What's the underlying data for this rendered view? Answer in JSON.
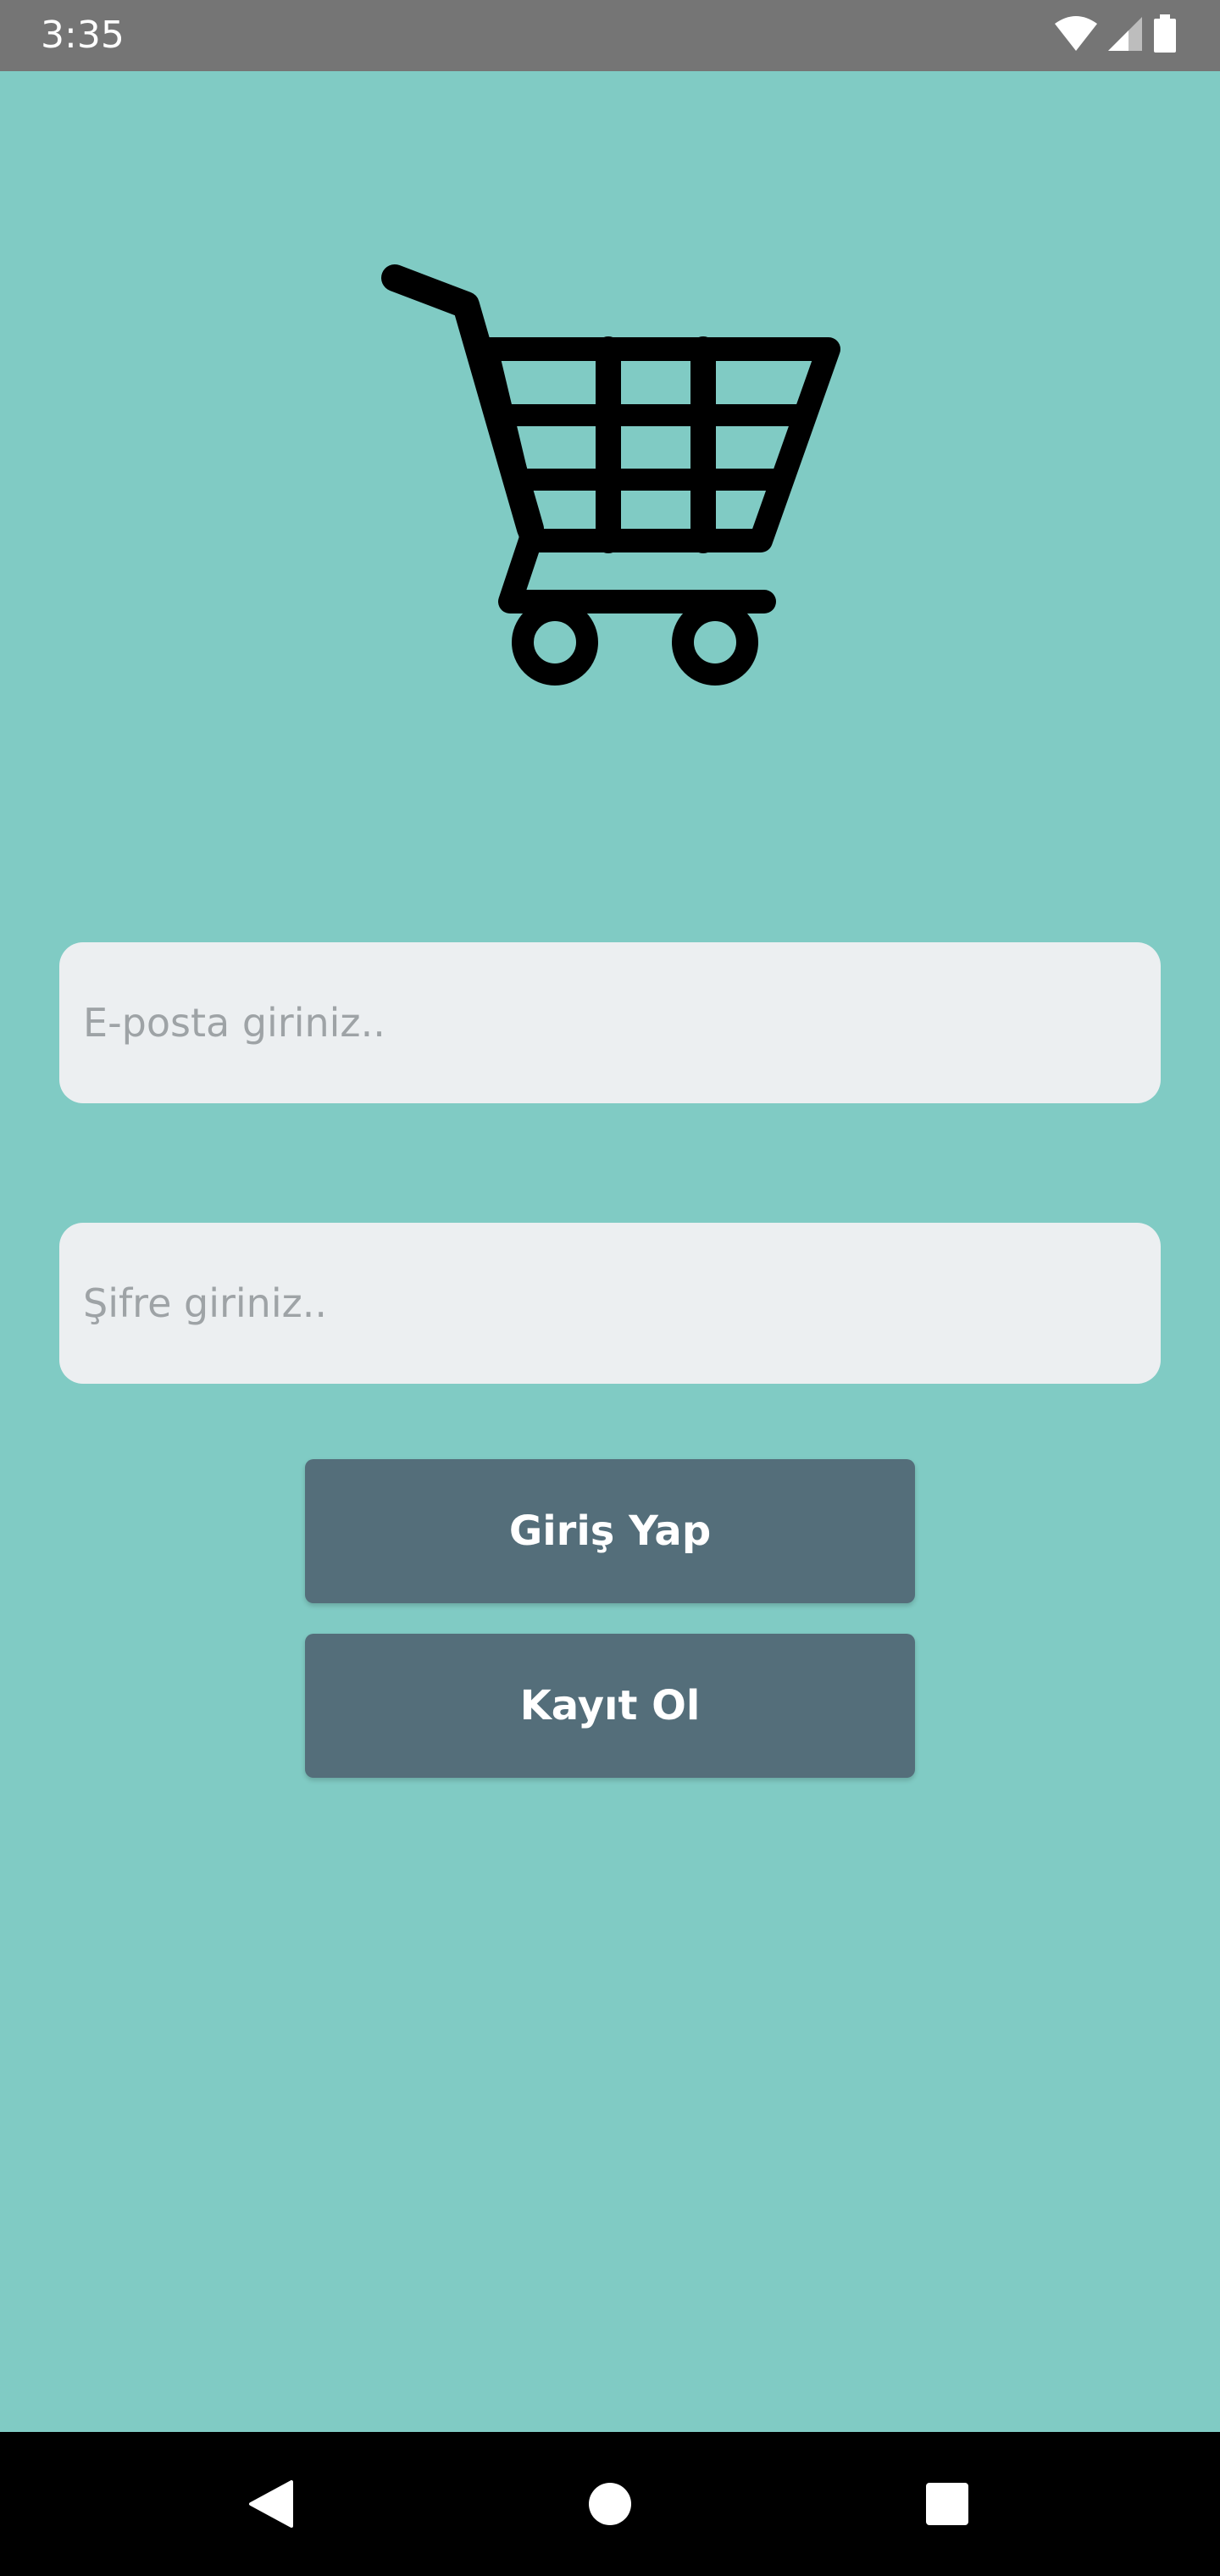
{
  "status_bar": {
    "time": "3:35",
    "icons": [
      "wifi-icon",
      "cellular-signal-icon",
      "battery-icon"
    ]
  },
  "logo": {
    "icon": "shopping-cart-icon"
  },
  "form": {
    "email": {
      "placeholder": "E-posta giriniz..",
      "value": ""
    },
    "password": {
      "placeholder": "Şifre giriniz..",
      "value": ""
    },
    "login_label": "Giriş Yap",
    "register_label": "Kayıt Ol"
  },
  "nav_bar": {
    "buttons": [
      "back-icon",
      "home-icon",
      "recents-icon"
    ]
  },
  "colors": {
    "background": "#80cbc4",
    "status_bar": "#757575",
    "input_background": "#eceff1",
    "button": "#546e7a",
    "button_text": "#ffffff",
    "nav_bar": "#000000"
  }
}
